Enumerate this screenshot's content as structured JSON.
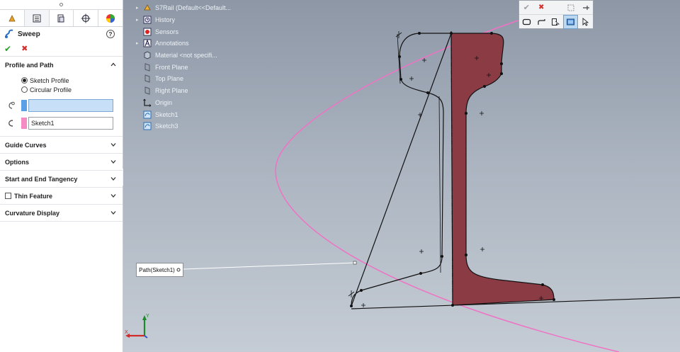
{
  "property_manager": {
    "feature_title": "Sweep",
    "help_glyph": "?",
    "ok_glyph": "✔",
    "cancel_glyph": "✖",
    "sections": {
      "profile_and_path": {
        "title": "Profile and Path",
        "radio_sketch_profile": "Sketch Profile",
        "radio_circular_profile": "Circular Profile",
        "selected_radio": "Sketch Profile",
        "profile_selection_value": "",
        "path_selection_value": "Sketch1",
        "profile_color": "#5aa0e6",
        "path_color": "#f58bc4"
      },
      "guide_curves": {
        "title": "Guide Curves"
      },
      "options": {
        "title": "Options"
      },
      "start_end_tangency": {
        "title": "Start and End Tangency"
      },
      "thin_feature": {
        "title": "Thin Feature",
        "checked": false
      },
      "curvature_display": {
        "title": "Curvature Display"
      }
    }
  },
  "feature_tree": {
    "root": "S7Rail  (Default<<Default...",
    "items": [
      {
        "label": "History",
        "icon": "history-icon",
        "expandable": true
      },
      {
        "label": "Sensors",
        "icon": "sensors-icon",
        "expandable": false
      },
      {
        "label": "Annotations",
        "icon": "annotations-icon",
        "expandable": true
      },
      {
        "label": "Material <not specifi...",
        "icon": "material-icon",
        "expandable": false
      },
      {
        "label": "Front Plane",
        "icon": "plane-icon",
        "expandable": false
      },
      {
        "label": "Top Plane",
        "icon": "plane-icon",
        "expandable": false
      },
      {
        "label": "Right Plane",
        "icon": "plane-icon",
        "expandable": false
      },
      {
        "label": "Origin",
        "icon": "origin-icon",
        "expandable": false
      },
      {
        "label": "Sketch1",
        "icon": "sketch-icon",
        "expandable": false
      },
      {
        "label": "Sketch3",
        "icon": "sketch-icon",
        "expandable": false
      }
    ]
  },
  "viewport": {
    "path_callout": "Path(Sketch1)",
    "profile_fill_color": "#8a3b44",
    "path_curve_color": "#f072c4",
    "triad": {
      "x_label": "X",
      "y_label": "Y"
    }
  },
  "confirm_toolbar": {
    "ok_glyph": "✔",
    "cancel_glyph": "✖"
  }
}
